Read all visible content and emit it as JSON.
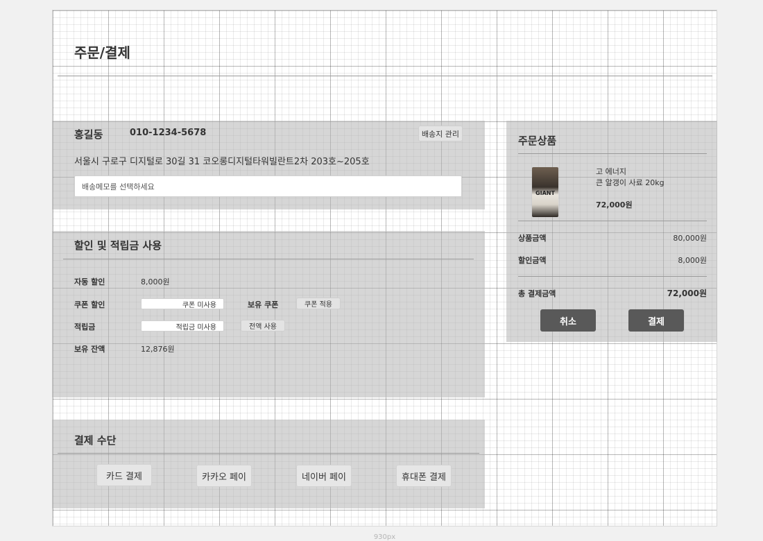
{
  "page": {
    "title": "주문/결제",
    "width_caption": "930px"
  },
  "shipping": {
    "name": "홍길동",
    "phone": "010-1234-5678",
    "manage_button": "배송지 관리",
    "address": "서울시 구로구 디지털로 30길 31 코오롱디지털타워빌란트2차 203호~205호",
    "memo_placeholder": "배송메모를 선택하세요"
  },
  "discount": {
    "title": "할인 및 적립금 사용",
    "auto_label": "자동 할인",
    "auto_value": "8,000원",
    "coupon_label": "쿠폰 할인",
    "coupon_value": "쿠폰 미사용",
    "owned_coupon_label": "보유 쿠폰",
    "coupon_apply_button": "쿠폰 적용",
    "points_label": "적립금",
    "points_value": "적립금 미사용",
    "points_all_button": "전액 사용",
    "balance_label": "보유 잔액",
    "balance_value": "12,876원"
  },
  "payment": {
    "title": "결제 수단",
    "methods": [
      "카드 결제",
      "카카오 페이",
      "네이버 페이",
      "휴대폰 결제"
    ]
  },
  "order": {
    "title": "주문상품",
    "product_brand_text": "GIANT",
    "product_line1": "고 에너지",
    "product_line2": "큰 알갱이 사료 20kg",
    "product_price": "72,000원",
    "subtotal_label": "상품금액",
    "subtotal_value": "80,000원",
    "discount_label": "할인금액",
    "discount_value": "8,000원",
    "total_label": "총 결제금액",
    "total_value": "72,000원",
    "cancel_button": "취소",
    "pay_button": "결제"
  },
  "colors": {
    "panel": "#c8c8c8",
    "dark_button": "#595959",
    "background": "#f1f1f1"
  }
}
